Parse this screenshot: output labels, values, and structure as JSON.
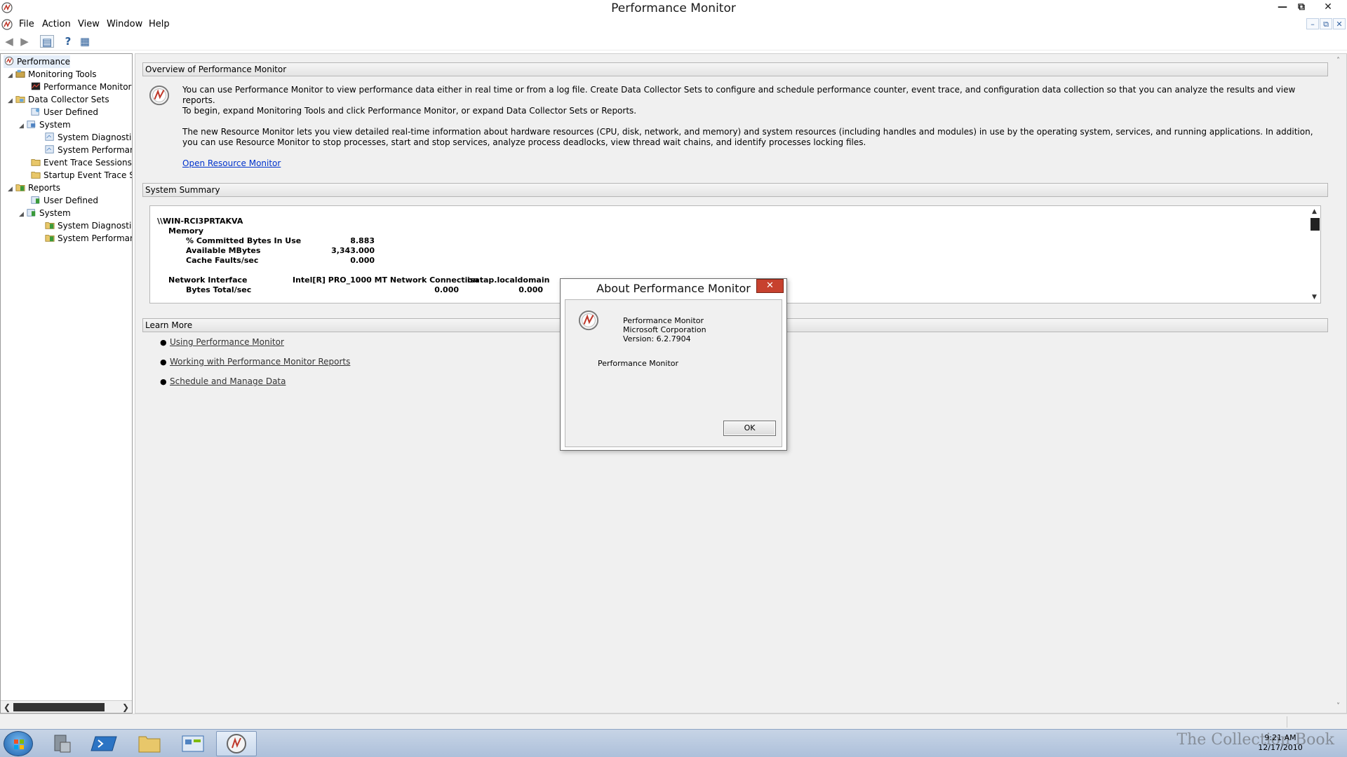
{
  "window": {
    "title": "Performance Monitor"
  },
  "menu": {
    "items": [
      "File",
      "Action",
      "View",
      "Window",
      "Help"
    ]
  },
  "tree": {
    "items": [
      {
        "label": "Performance"
      },
      {
        "label": "Monitoring Tools"
      },
      {
        "label": "Performance Monitor"
      },
      {
        "label": "Data Collector Sets"
      },
      {
        "label": "User Defined"
      },
      {
        "label": "System"
      },
      {
        "label": "System Diagnostics"
      },
      {
        "label": "System Performance"
      },
      {
        "label": "Event Trace Sessions"
      },
      {
        "label": "Startup Event Trace Sessions"
      },
      {
        "label": "Reports"
      },
      {
        "label": "User Defined"
      },
      {
        "label": "System"
      },
      {
        "label": "System Diagnostics"
      },
      {
        "label": "System Performance"
      }
    ]
  },
  "overview": {
    "header": "Overview of Performance Monitor",
    "p1": "You can use Performance Monitor to view performance data either in real time or from a log file. Create Data Collector Sets to configure and schedule performance counter, event trace, and configuration data collection so that you can analyze the results and view reports.",
    "p2": "To begin, expand Monitoring Tools and click Performance Monitor, or expand Data Collector Sets or Reports.",
    "p3": "The new Resource Monitor lets you view detailed real-time information about hardware resources (CPU, disk, network, and memory) and system resources (including handles and modules) in use by the operating system, services, and running applications. In addition, you can use Resource Monitor to stop processes, start and stop services, analyze process deadlocks, view thread wait chains, and identify processes locking files.",
    "link": "Open Resource Monitor"
  },
  "summary": {
    "header": "System Summary",
    "machine": "\\\\WIN-RCI3PRTAKVA",
    "memory": {
      "label": "Memory",
      "rows": [
        {
          "name": "% Committed Bytes In Use",
          "value": "8.883"
        },
        {
          "name": "Available MBytes",
          "value": "3,343.000"
        },
        {
          "name": "Cache Faults/sec",
          "value": "0.000"
        }
      ]
    },
    "network": {
      "label": "Network Interface",
      "col1": "Intel[R] PRO_1000 MT Network Connection",
      "col2": "isatap.localdomain",
      "row_name": "Bytes Total/sec",
      "val1": "0.000",
      "val2": "0.000"
    }
  },
  "learn": {
    "header": "Learn More",
    "links": [
      "Using Performance Monitor",
      "Working with Performance Monitor Reports",
      "Schedule and Manage Data"
    ]
  },
  "dialog": {
    "title": "About Performance Monitor",
    "close": "✕",
    "product": "Performance Monitor",
    "company": "Microsoft Corporation",
    "version": "Version: 6.2.7904",
    "description": "Performance Monitor",
    "ok": "OK"
  },
  "taskbar": {
    "time": "9:21 AM",
    "date": "12/17/2010",
    "watermark": "The Collection Book"
  },
  "colors": {
    "dialog_close": "#c7412e",
    "link": "#0033cc",
    "section_header": "#e4e4e4"
  }
}
